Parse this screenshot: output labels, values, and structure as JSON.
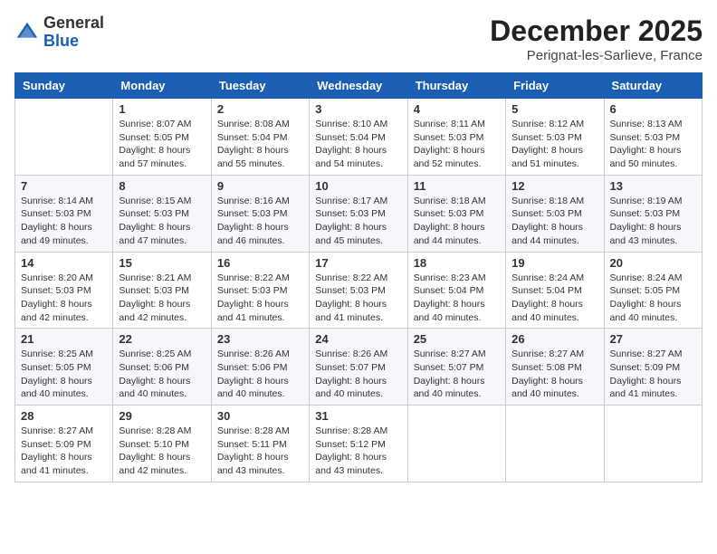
{
  "header": {
    "logo_general": "General",
    "logo_blue": "Blue",
    "month_year": "December 2025",
    "location": "Perignat-les-Sarlieve, France"
  },
  "days_of_week": [
    "Sunday",
    "Monday",
    "Tuesday",
    "Wednesday",
    "Thursday",
    "Friday",
    "Saturday"
  ],
  "weeks": [
    [
      {
        "day": "",
        "info": ""
      },
      {
        "day": "1",
        "info": "Sunrise: 8:07 AM\nSunset: 5:05 PM\nDaylight: 8 hours\nand 57 minutes."
      },
      {
        "day": "2",
        "info": "Sunrise: 8:08 AM\nSunset: 5:04 PM\nDaylight: 8 hours\nand 55 minutes."
      },
      {
        "day": "3",
        "info": "Sunrise: 8:10 AM\nSunset: 5:04 PM\nDaylight: 8 hours\nand 54 minutes."
      },
      {
        "day": "4",
        "info": "Sunrise: 8:11 AM\nSunset: 5:03 PM\nDaylight: 8 hours\nand 52 minutes."
      },
      {
        "day": "5",
        "info": "Sunrise: 8:12 AM\nSunset: 5:03 PM\nDaylight: 8 hours\nand 51 minutes."
      },
      {
        "day": "6",
        "info": "Sunrise: 8:13 AM\nSunset: 5:03 PM\nDaylight: 8 hours\nand 50 minutes."
      }
    ],
    [
      {
        "day": "7",
        "info": "Sunrise: 8:14 AM\nSunset: 5:03 PM\nDaylight: 8 hours\nand 49 minutes."
      },
      {
        "day": "8",
        "info": "Sunrise: 8:15 AM\nSunset: 5:03 PM\nDaylight: 8 hours\nand 47 minutes."
      },
      {
        "day": "9",
        "info": "Sunrise: 8:16 AM\nSunset: 5:03 PM\nDaylight: 8 hours\nand 46 minutes."
      },
      {
        "day": "10",
        "info": "Sunrise: 8:17 AM\nSunset: 5:03 PM\nDaylight: 8 hours\nand 45 minutes."
      },
      {
        "day": "11",
        "info": "Sunrise: 8:18 AM\nSunset: 5:03 PM\nDaylight: 8 hours\nand 44 minutes."
      },
      {
        "day": "12",
        "info": "Sunrise: 8:18 AM\nSunset: 5:03 PM\nDaylight: 8 hours\nand 44 minutes."
      },
      {
        "day": "13",
        "info": "Sunrise: 8:19 AM\nSunset: 5:03 PM\nDaylight: 8 hours\nand 43 minutes."
      }
    ],
    [
      {
        "day": "14",
        "info": "Sunrise: 8:20 AM\nSunset: 5:03 PM\nDaylight: 8 hours\nand 42 minutes."
      },
      {
        "day": "15",
        "info": "Sunrise: 8:21 AM\nSunset: 5:03 PM\nDaylight: 8 hours\nand 42 minutes."
      },
      {
        "day": "16",
        "info": "Sunrise: 8:22 AM\nSunset: 5:03 PM\nDaylight: 8 hours\nand 41 minutes."
      },
      {
        "day": "17",
        "info": "Sunrise: 8:22 AM\nSunset: 5:03 PM\nDaylight: 8 hours\nand 41 minutes."
      },
      {
        "day": "18",
        "info": "Sunrise: 8:23 AM\nSunset: 5:04 PM\nDaylight: 8 hours\nand 40 minutes."
      },
      {
        "day": "19",
        "info": "Sunrise: 8:24 AM\nSunset: 5:04 PM\nDaylight: 8 hours\nand 40 minutes."
      },
      {
        "day": "20",
        "info": "Sunrise: 8:24 AM\nSunset: 5:05 PM\nDaylight: 8 hours\nand 40 minutes."
      }
    ],
    [
      {
        "day": "21",
        "info": "Sunrise: 8:25 AM\nSunset: 5:05 PM\nDaylight: 8 hours\nand 40 minutes."
      },
      {
        "day": "22",
        "info": "Sunrise: 8:25 AM\nSunset: 5:06 PM\nDaylight: 8 hours\nand 40 minutes."
      },
      {
        "day": "23",
        "info": "Sunrise: 8:26 AM\nSunset: 5:06 PM\nDaylight: 8 hours\nand 40 minutes."
      },
      {
        "day": "24",
        "info": "Sunrise: 8:26 AM\nSunset: 5:07 PM\nDaylight: 8 hours\nand 40 minutes."
      },
      {
        "day": "25",
        "info": "Sunrise: 8:27 AM\nSunset: 5:07 PM\nDaylight: 8 hours\nand 40 minutes."
      },
      {
        "day": "26",
        "info": "Sunrise: 8:27 AM\nSunset: 5:08 PM\nDaylight: 8 hours\nand 40 minutes."
      },
      {
        "day": "27",
        "info": "Sunrise: 8:27 AM\nSunset: 5:09 PM\nDaylight: 8 hours\nand 41 minutes."
      }
    ],
    [
      {
        "day": "28",
        "info": "Sunrise: 8:27 AM\nSunset: 5:09 PM\nDaylight: 8 hours\nand 41 minutes."
      },
      {
        "day": "29",
        "info": "Sunrise: 8:28 AM\nSunset: 5:10 PM\nDaylight: 8 hours\nand 42 minutes."
      },
      {
        "day": "30",
        "info": "Sunrise: 8:28 AM\nSunset: 5:11 PM\nDaylight: 8 hours\nand 43 minutes."
      },
      {
        "day": "31",
        "info": "Sunrise: 8:28 AM\nSunset: 5:12 PM\nDaylight: 8 hours\nand 43 minutes."
      },
      {
        "day": "",
        "info": ""
      },
      {
        "day": "",
        "info": ""
      },
      {
        "day": "",
        "info": ""
      }
    ]
  ]
}
